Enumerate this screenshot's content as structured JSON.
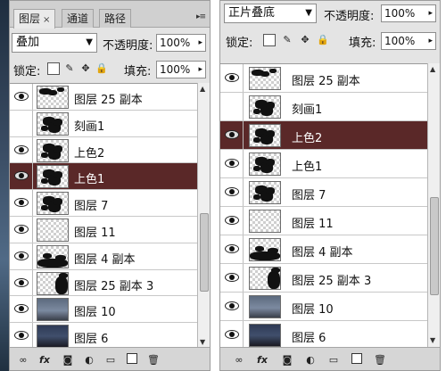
{
  "left_panel": {
    "tabs": [
      {
        "label": "图层",
        "close": "×",
        "active": true
      },
      {
        "label": "通道",
        "active": false
      },
      {
        "label": "路径",
        "active": false
      }
    ],
    "menu_icon": "▸≡",
    "blend_mode": "叠加",
    "opacity_label": "不透明度:",
    "opacity_value": "100%",
    "lock_label": "锁定:",
    "fill_label": "填充:",
    "fill_value": "100%",
    "layers": [
      {
        "name": "图层 25 副本",
        "visible": true,
        "selected": false,
        "thumb": "ink-top"
      },
      {
        "name": "刻画1",
        "visible": false,
        "selected": false,
        "thumb": "ink-tree"
      },
      {
        "name": "上色2",
        "visible": true,
        "selected": false,
        "thumb": "ink-tree"
      },
      {
        "name": "上色1",
        "visible": true,
        "selected": true,
        "thumb": "ink-tree"
      },
      {
        "name": "图层 7",
        "visible": true,
        "selected": false,
        "thumb": "ink-tree"
      },
      {
        "name": "图层 11",
        "visible": true,
        "selected": false,
        "thumb": "empty"
      },
      {
        "name": "图层 4 副本",
        "visible": true,
        "selected": false,
        "thumb": "ink-bottom"
      },
      {
        "name": "图层 25 副本 3",
        "visible": true,
        "selected": false,
        "thumb": "ink-corner"
      },
      {
        "name": "图层 10",
        "visible": true,
        "selected": false,
        "thumb": "photo"
      },
      {
        "name": "图层 6",
        "visible": true,
        "selected": false,
        "thumb": "photo2"
      }
    ]
  },
  "right_panel": {
    "blend_mode": "正片叠底",
    "opacity_label": "不透明度:",
    "opacity_value": "100%",
    "lock_label": "锁定:",
    "fill_label": "填充:",
    "fill_value": "100%",
    "layers": [
      {
        "name": "图层 25 副本",
        "visible": true,
        "selected": false,
        "thumb": "ink-top"
      },
      {
        "name": "刻画1",
        "visible": false,
        "selected": false,
        "thumb": "ink-tree"
      },
      {
        "name": "上色2",
        "visible": true,
        "selected": true,
        "thumb": "ink-tree"
      },
      {
        "name": "上色1",
        "visible": true,
        "selected": false,
        "thumb": "ink-tree"
      },
      {
        "name": "图层 7",
        "visible": true,
        "selected": false,
        "thumb": "ink-tree"
      },
      {
        "name": "图层 11",
        "visible": true,
        "selected": false,
        "thumb": "empty"
      },
      {
        "name": "图层 4 副本",
        "visible": true,
        "selected": false,
        "thumb": "ink-bottom"
      },
      {
        "name": "图层 25 副本 3",
        "visible": true,
        "selected": false,
        "thumb": "ink-corner"
      },
      {
        "name": "图层 10",
        "visible": true,
        "selected": false,
        "thumb": "photo"
      },
      {
        "name": "图层 6",
        "visible": true,
        "selected": false,
        "thumb": "photo2"
      }
    ]
  },
  "footer_icons": [
    "link-icon",
    "fx-icon",
    "mask-icon",
    "adjustment-icon",
    "folder-icon",
    "new-layer-icon",
    "trash-icon"
  ],
  "footer_fx": "fx",
  "colors": {
    "selected_row": "#5a2828",
    "panel_bg": "#e4e4e4"
  }
}
